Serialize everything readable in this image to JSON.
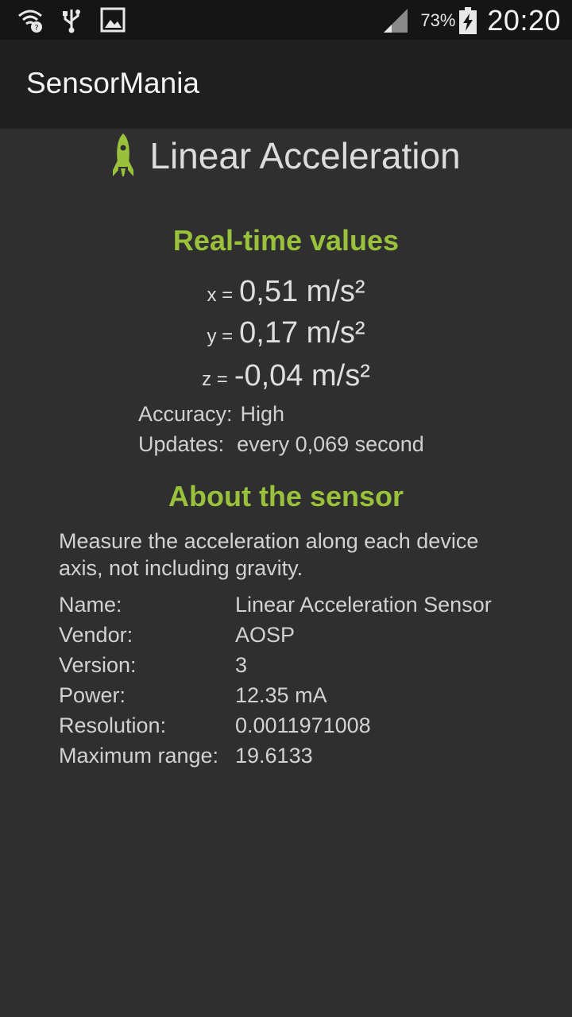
{
  "status_bar": {
    "battery_percent": "73%",
    "time": "20:20",
    "icons": [
      "wifi-question-icon",
      "usb-icon",
      "image-icon",
      "signal-icon",
      "battery-charging-icon"
    ]
  },
  "app_bar": {
    "title": "SensorMania"
  },
  "sensor": {
    "title": "Linear Acceleration",
    "icon": "rocket-icon",
    "accent_color": "#9ac13b"
  },
  "realtime": {
    "heading": "Real-time values",
    "axes": [
      {
        "label": "x =",
        "value": "0,51 m/s²"
      },
      {
        "label": "y =",
        "value": "0,17 m/s²"
      },
      {
        "label": "z =",
        "value": "-0,04 m/s²"
      }
    ],
    "accuracy_label": "Accuracy:",
    "accuracy_value": "High",
    "updates_label": "Updates:",
    "updates_value": "every 0,069 second"
  },
  "about": {
    "heading": "About the sensor",
    "description": "Measure the acceleration along each device axis, not including gravity.",
    "rows": [
      {
        "key": "Name:",
        "value": "Linear Acceleration Sensor"
      },
      {
        "key": "Vendor:",
        "value": "AOSP"
      },
      {
        "key": "Version:",
        "value": "3"
      },
      {
        "key": "Power:",
        "value": "12.35 mA"
      },
      {
        "key": "Resolution:",
        "value": "0.0011971008"
      },
      {
        "key": "Maximum range:",
        "value": "19.6133"
      }
    ]
  }
}
